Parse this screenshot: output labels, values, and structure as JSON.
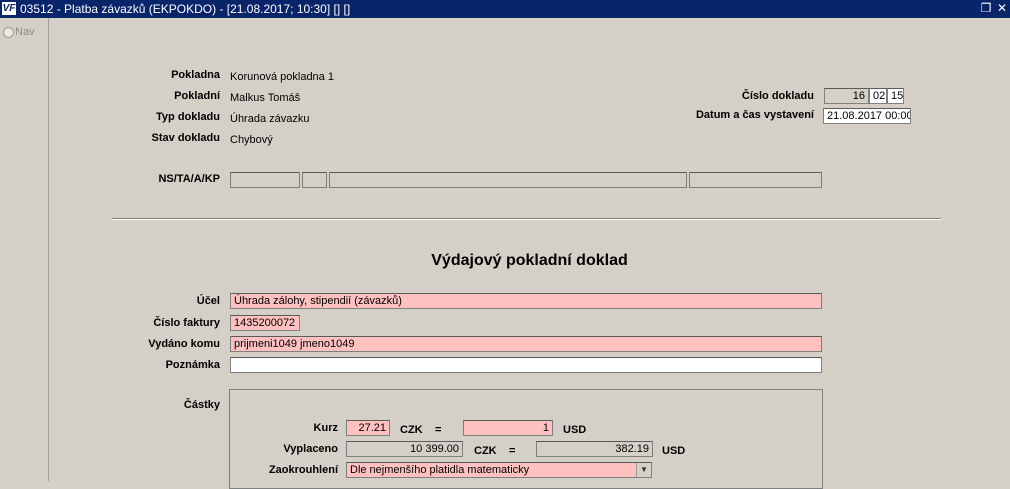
{
  "window": {
    "logo": "VF",
    "title": "03512 - Platba závazků (EKPOKDO) - [21.08.2017; 10:30]  [] []",
    "restore_glyph": "❐",
    "close_glyph": "✕"
  },
  "sidebar": {
    "nav_label": "Nav"
  },
  "header_info": {
    "pokladna_label": "Pokladna",
    "pokladna_value": "Korunová pokladna 1",
    "pokladni_label": "Pokladní",
    "pokladni_value": "Malkus Tomáš",
    "typ_label": "Typ dokladu",
    "typ_value": "Úhrada závazku",
    "stav_label": "Stav dokladu",
    "stav_value": "Chybový",
    "cislo_label": "Číslo dokladu",
    "cislo_parts": [
      "16",
      "02",
      "15"
    ],
    "datum_label": "Datum a čas vystavení",
    "datum_value": "21.08.2017 00:00",
    "nstaakp_label": "NS/TA/A/KP",
    "nstaakp_values": [
      "",
      "",
      "",
      ""
    ]
  },
  "document": {
    "heading": "Výdajový pokladní doklad",
    "ucel_label": "Účel",
    "ucel_value": "Úhrada zálohy, stipendií  (závazků)",
    "faktura_label": "Číslo faktury",
    "faktura_value": "1435200072",
    "vydano_label": "Vydáno komu",
    "vydano_value": "prijmeni1049 jmeno1049",
    "poznamka_label": "Poznámka",
    "poznamka_value": ""
  },
  "amounts": {
    "section_label": "Částky",
    "kurz_label": "Kurz",
    "kurz_value": "27.21",
    "czk_label": "CZK",
    "eq_label": "=",
    "kurz_usd_value": "1",
    "usd_label": "USD",
    "vyplaceno_label": "Vyplaceno",
    "vyplaceno_czk_value": "10 399.00",
    "vyplaceno_usd_value": "382.19",
    "zaokrouhleni_label": "Zaokrouhlení",
    "zaokrouhleni_value": "Dle nejmenšího platidla matematicky"
  },
  "colors": {
    "title_bar": "#0a246a",
    "required_field": "#ffc0c0",
    "background": "#d4d0c8"
  }
}
